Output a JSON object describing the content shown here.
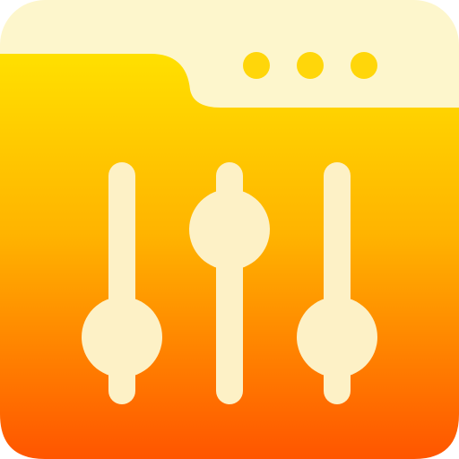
{
  "icon": {
    "name": "folder-settings-sliders",
    "colors": {
      "header_cream": "#FDF6CC",
      "gradient_top": "#FFE000",
      "gradient_mid": "#FFB300",
      "gradient_bottom": "#FF5500",
      "slider_fill": "#FDF1C6",
      "dots": "#FFD60A"
    },
    "sliders": [
      {
        "name": "slider-left",
        "level": 0.14
      },
      {
        "name": "slider-middle",
        "level": 0.72
      },
      {
        "name": "slider-right",
        "level": 0.14
      }
    ],
    "dot_count": 3
  }
}
